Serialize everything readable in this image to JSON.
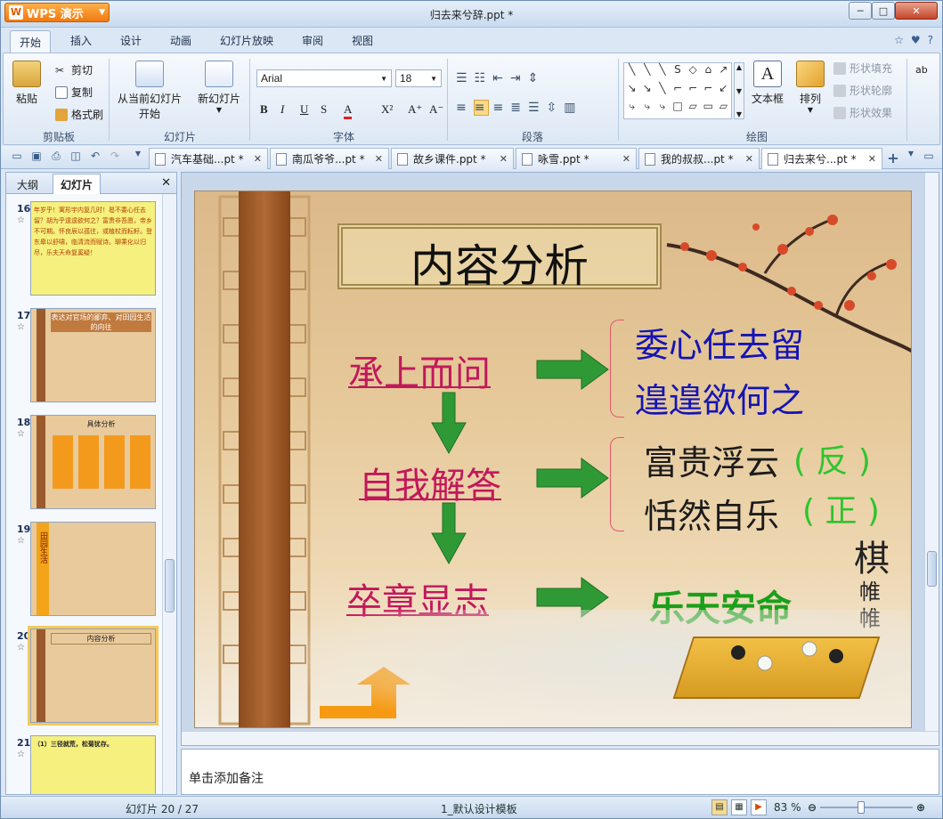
{
  "window": {
    "title": "归去来兮辞.ppt *",
    "app_button": "WPS 演示",
    "app_logo": "W"
  },
  "controls": {
    "min": "─",
    "max": "□",
    "close": "✕"
  },
  "ribbon_tabs": [
    "开始",
    "插入",
    "设计",
    "动画",
    "幻灯片放映",
    "审阅",
    "视图"
  ],
  "help_icons": {
    "star": "☆",
    "shirt": "♥",
    "help": "?"
  },
  "clipboard": {
    "paste": "粘贴",
    "cut": "剪切",
    "copy": "复制",
    "format_painter": "格式刷",
    "group": "剪贴板"
  },
  "slides_group": {
    "from_current": "从当前幻灯片",
    "from_current_2": "开始",
    "new_slide": "新幻灯片",
    "group": "幻灯片"
  },
  "font_group": {
    "font_name": "Arial",
    "font_size": "18",
    "bold": "B",
    "italic": "I",
    "underline": "U",
    "strike": "S",
    "font_color": "A",
    "superscript": "X²",
    "grow": "A⁺",
    "shrink": "A⁻",
    "group": "字体"
  },
  "paragraph_group": {
    "group": "段落"
  },
  "drawing_group": {
    "text_box": "文本框",
    "arrange": "排列",
    "shape_fill": "形状填充",
    "shape_outline": "形状轮廓",
    "shape_effect": "形状效果",
    "group": "绘图"
  },
  "shape_gallery": [
    "╲",
    "╲",
    "╲",
    "S",
    "◇",
    "⌂",
    "↗",
    "↘",
    "↘",
    "╲",
    "⌐",
    "⌐",
    "⌐",
    "↙",
    "⤷",
    "⤷",
    "⤷",
    "□",
    "▱",
    "▭",
    "▱"
  ],
  "doc_tabs": [
    {
      "label": "汽车基础...pt *"
    },
    {
      "label": "南瓜爷爷...pt *"
    },
    {
      "label": "故乡课件.ppt *"
    },
    {
      "label": "咏雪.ppt *"
    },
    {
      "label": "我的叔叔...pt *"
    },
    {
      "label": "归去来兮...pt *"
    }
  ],
  "doc_tab_close": "✕",
  "left_panel": {
    "tab_outline": "大纲",
    "tab_slides": "幻灯片",
    "close": "✕"
  },
  "thumbnails": [
    {
      "num": "16",
      "star": "☆",
      "text": "年岁乎！寓形宇内复几时！曷不委心任去留？胡为乎遑遑欲何之？富贵非吾愿，帝乡不可期。怀良辰以孤往，或植杖而耘耔。登东皋以舒啸，临清流而赋诗。聊乘化以归尽，乐夫天命复奚疑！"
    },
    {
      "num": "17",
      "star": "☆",
      "title": "表达对官场的鄙弃、对田园生活的向往"
    },
    {
      "num": "18",
      "star": "☆",
      "title": "具体分析"
    },
    {
      "num": "19",
      "star": "☆",
      "title": "田园生活"
    },
    {
      "num": "20",
      "star": "☆",
      "title": "内容分析"
    },
    {
      "num": "21",
      "star": "☆",
      "text": "（1）三径就荒，松菊犹存。"
    }
  ],
  "slide": {
    "title": "内容分析",
    "left_items": [
      "承上而问",
      "自我解答",
      "卒章显志"
    ],
    "right_top": [
      "委心任去留",
      "遑遑欲何之"
    ],
    "right_mid": [
      "富贵浮云",
      "( 反 )",
      "恬然自乐",
      "( 正 )"
    ],
    "right_bottom": "乐天安命",
    "calligraphy": [
      "棋",
      "帷",
      "帷"
    ],
    "colors": {
      "left_items": "#c2185b",
      "top_right": "#1414b4",
      "bottom_right": "#1aa01a",
      "arrows": "#2f9a35",
      "paren": "#2ec42e"
    }
  },
  "notes_placeholder": "单击添加备注",
  "status": {
    "slide_counter": "幻灯片 20 / 27",
    "template": "1_默认设计模板",
    "zoom": "83 %"
  }
}
